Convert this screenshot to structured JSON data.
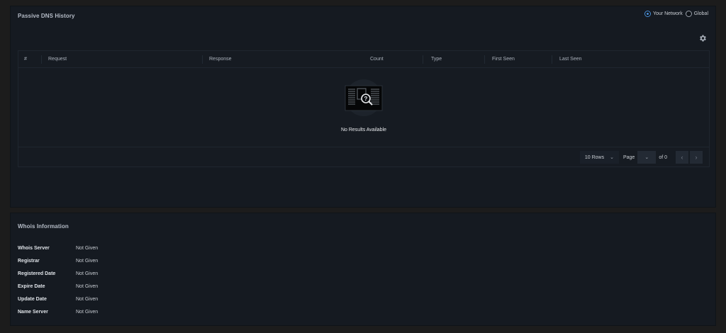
{
  "dns": {
    "title": "Passive DNS History",
    "scope": {
      "options": [
        "Your Network",
        "Global"
      ],
      "selected": "Your Network"
    },
    "settings_icon": "gear-icon",
    "columns": [
      "#",
      "Request",
      "Response",
      "Count",
      "Type",
      "First Seen",
      "Last Seen"
    ],
    "empty_icon": "no-results-search-icon",
    "empty_text": "No Results Available",
    "pager": {
      "rows_label": "10 Rows",
      "page_label": "Page",
      "page_value": "",
      "of_label": "of 0",
      "prev_icon": "chevron-left-icon",
      "next_icon": "chevron-right-icon"
    }
  },
  "whois": {
    "title": "Whois Information",
    "rows": [
      {
        "key": "Whois Server",
        "value": "Not Given"
      },
      {
        "key": "Registrar",
        "value": "Not Given"
      },
      {
        "key": "Registered Date",
        "value": "Not Given"
      },
      {
        "key": "Expire Date",
        "value": "Not Given"
      },
      {
        "key": "Update Date",
        "value": "Not Given"
      },
      {
        "key": "Name Server",
        "value": "Not Given"
      }
    ]
  },
  "colors": {
    "page_bg": "#1c1c1c",
    "panel_bg": "#151a21",
    "accent": "#4a8fd8"
  }
}
